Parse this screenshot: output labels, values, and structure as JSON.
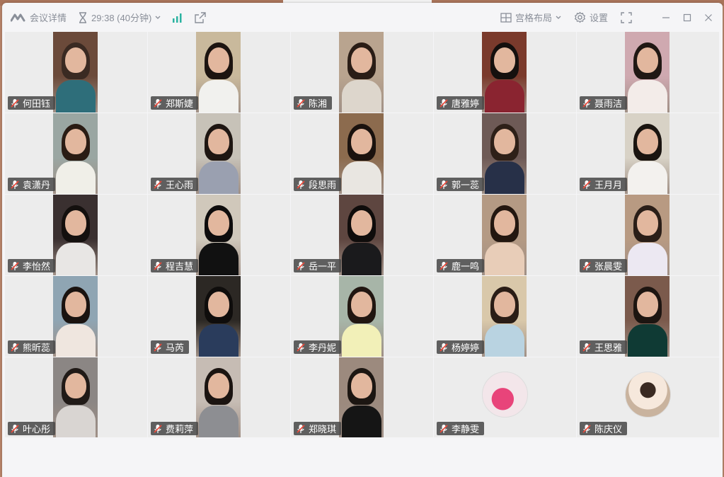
{
  "header": {
    "meeting_details": "会议详情",
    "timer": "29:38 (40分钟)",
    "layout_label": "宫格布局",
    "settings_label": "设置"
  },
  "colors": {
    "accent_bar": "#2bb3a1",
    "muted_mic": "#e84a3b",
    "window_bg": "#f5f5f7",
    "tile_bg": "#ececec"
  },
  "participants": [
    {
      "name": "何田钰",
      "kind": "video"
    },
    {
      "name": "郑斯婕",
      "kind": "video"
    },
    {
      "name": "陈湘",
      "kind": "video"
    },
    {
      "name": "唐雅婷",
      "kind": "video"
    },
    {
      "name": "聂雨洁",
      "kind": "video"
    },
    {
      "name": "袁潇丹",
      "kind": "video"
    },
    {
      "name": "王心雨",
      "kind": "video"
    },
    {
      "name": "段思雨",
      "kind": "video"
    },
    {
      "name": "郭一蕊",
      "kind": "video"
    },
    {
      "name": "王月月",
      "kind": "video"
    },
    {
      "name": "李怡然",
      "kind": "video"
    },
    {
      "name": "程吉慧",
      "kind": "video"
    },
    {
      "name": "岳一平",
      "kind": "video"
    },
    {
      "name": "鹿一鸣",
      "kind": "video"
    },
    {
      "name": "张晨雯",
      "kind": "video"
    },
    {
      "name": "熊昕蕊",
      "kind": "video"
    },
    {
      "name": "马芮",
      "kind": "video"
    },
    {
      "name": "李丹妮",
      "kind": "video"
    },
    {
      "name": "杨婷婷",
      "kind": "video"
    },
    {
      "name": "王思雅",
      "kind": "video"
    },
    {
      "name": "叶心彤",
      "kind": "video"
    },
    {
      "name": "费莉萍",
      "kind": "video"
    },
    {
      "name": "郑晓琪",
      "kind": "video"
    },
    {
      "name": "李静雯",
      "kind": "avatar"
    },
    {
      "name": "陈庆仪",
      "kind": "avatar"
    }
  ]
}
